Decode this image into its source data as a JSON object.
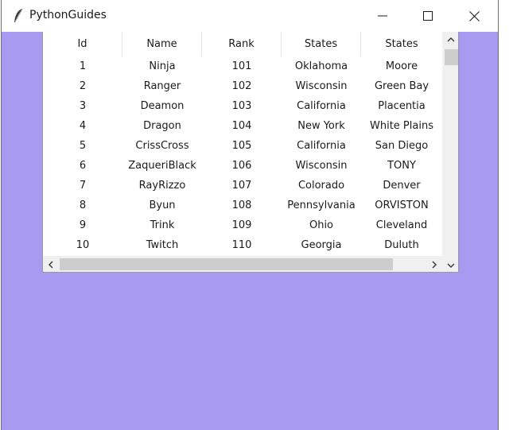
{
  "window": {
    "title": "PythonGuides",
    "icons": {
      "app": "feather-icon",
      "minimize": "minimize-icon",
      "maximize": "maximize-icon",
      "close": "close-icon"
    }
  },
  "colors": {
    "client_background": "#a99af1"
  },
  "table": {
    "columns": [
      "Id",
      "Name",
      "Rank",
      "States",
      "States"
    ],
    "rows": [
      [
        "1",
        "Ninja",
        "101",
        "Oklahoma",
        "Moore"
      ],
      [
        "2",
        "Ranger",
        "102",
        "Wisconsin",
        "Green Bay"
      ],
      [
        "3",
        "Deamon",
        "103",
        "California",
        "Placentia"
      ],
      [
        "4",
        "Dragon",
        "104",
        "New York",
        "White Plains"
      ],
      [
        "5",
        "CrissCross",
        "105",
        "California",
        "San Diego"
      ],
      [
        "6",
        "ZaqueriBlack",
        "106",
        "Wisconsin",
        "TONY"
      ],
      [
        "7",
        "RayRizzo",
        "107",
        "Colorado",
        "Denver"
      ],
      [
        "8",
        "Byun",
        "108",
        "Pennsylvania",
        "ORVISTON"
      ],
      [
        "9",
        "Trink",
        "109",
        "Ohio",
        "Cleveland"
      ],
      [
        "10",
        "Twitch",
        "110",
        "Georgia",
        "Duluth"
      ]
    ]
  }
}
